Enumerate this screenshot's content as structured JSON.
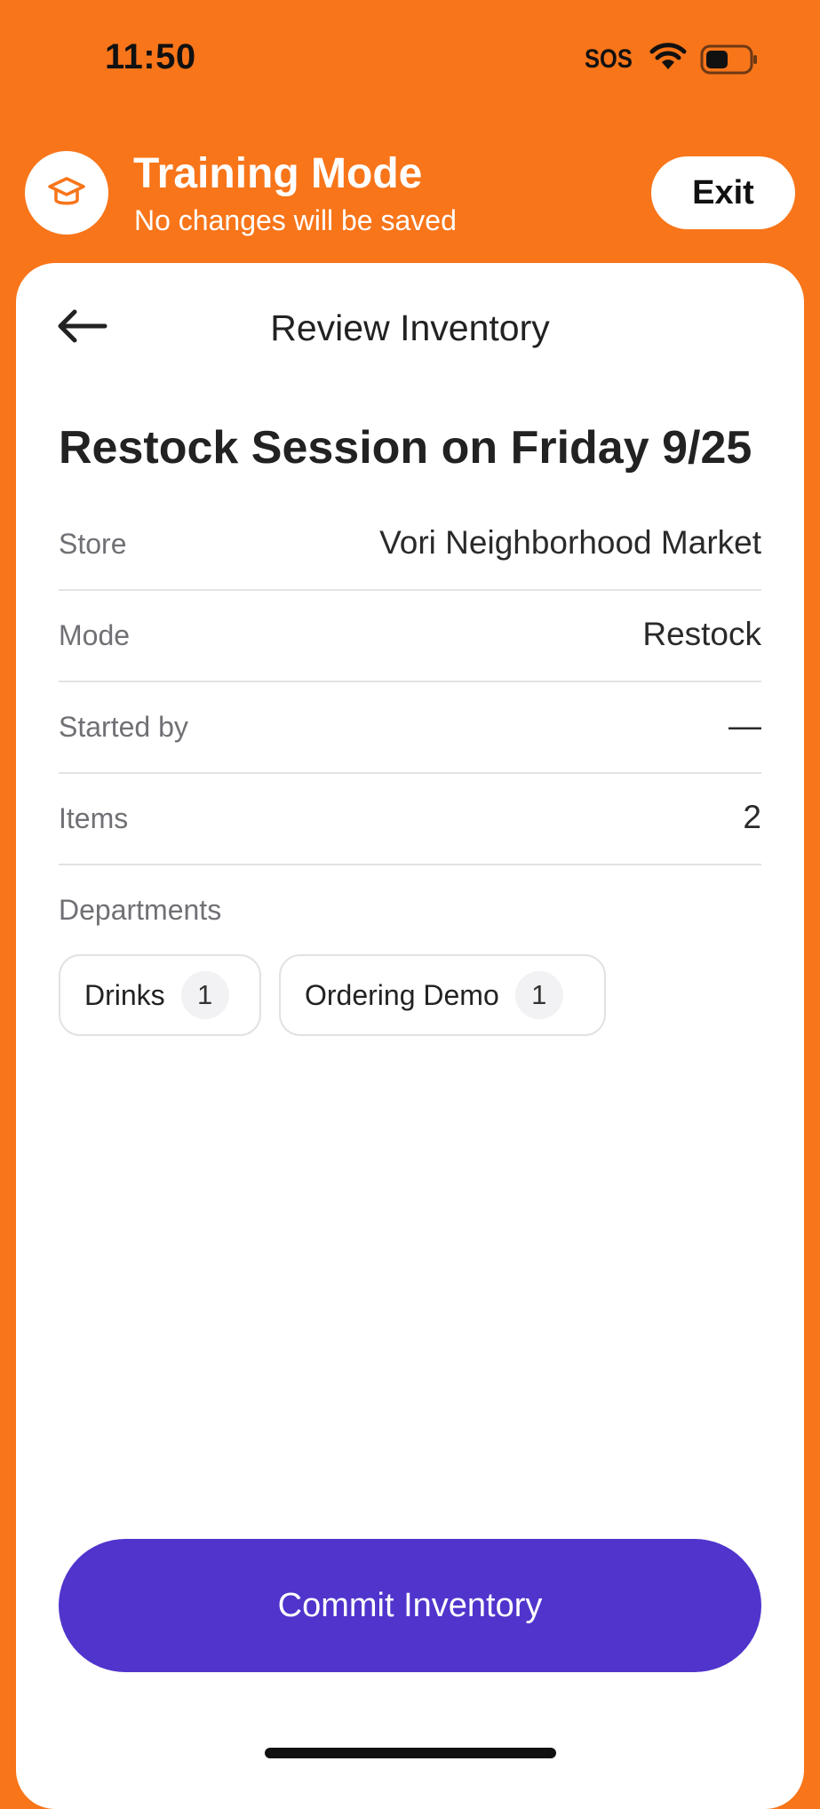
{
  "status_bar": {
    "time": "11:50",
    "sos": "SOS",
    "wifi_icon": "wifi-icon",
    "battery_icon": "battery-icon"
  },
  "training_banner": {
    "icon": "graduation-cap-icon",
    "title": "Training Mode",
    "subtitle": "No changes will be saved",
    "exit_label": "Exit"
  },
  "header": {
    "back_icon": "arrow-left-icon",
    "title": "Review Inventory"
  },
  "session": {
    "title": "Restock Session on Friday 9/25",
    "details": [
      {
        "label": "Store",
        "value": "Vori Neighborhood Market"
      },
      {
        "label": "Mode",
        "value": "Restock"
      },
      {
        "label": "Started by",
        "value": "—"
      },
      {
        "label": "Items",
        "value": "2"
      }
    ],
    "departments_label": "Departments",
    "departments": [
      {
        "name": "Drinks",
        "count": "1"
      },
      {
        "name": "Ordering Demo",
        "count": "1"
      }
    ]
  },
  "actions": {
    "commit_label": "Commit Inventory"
  },
  "colors": {
    "brand_orange": "#F8751A",
    "primary_purple": "#5034CC",
    "background": "#FFFFFF"
  }
}
